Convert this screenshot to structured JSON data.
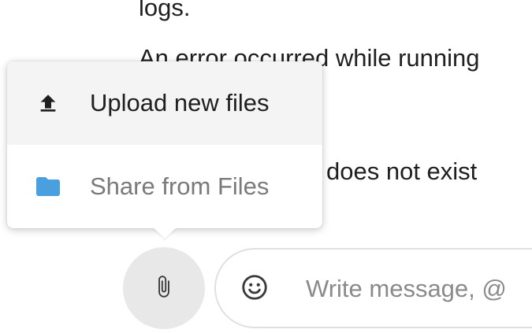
{
  "chat": {
    "line1": "logs.",
    "line2": "An error occurred while running",
    "line3": "does not exist"
  },
  "attach_menu": {
    "items": [
      {
        "label": "Upload new files",
        "icon": "upload-icon"
      },
      {
        "label": "Share from Files",
        "icon": "folder-icon"
      }
    ]
  },
  "composer": {
    "attach_icon": "paperclip-icon",
    "emoji_icon": "smiley-icon",
    "placeholder": "Write message, @"
  },
  "colors": {
    "folder": "#4a9fde",
    "menu_highlight": "#f4f4f4",
    "attach_button_bg": "#e8e8e8"
  }
}
